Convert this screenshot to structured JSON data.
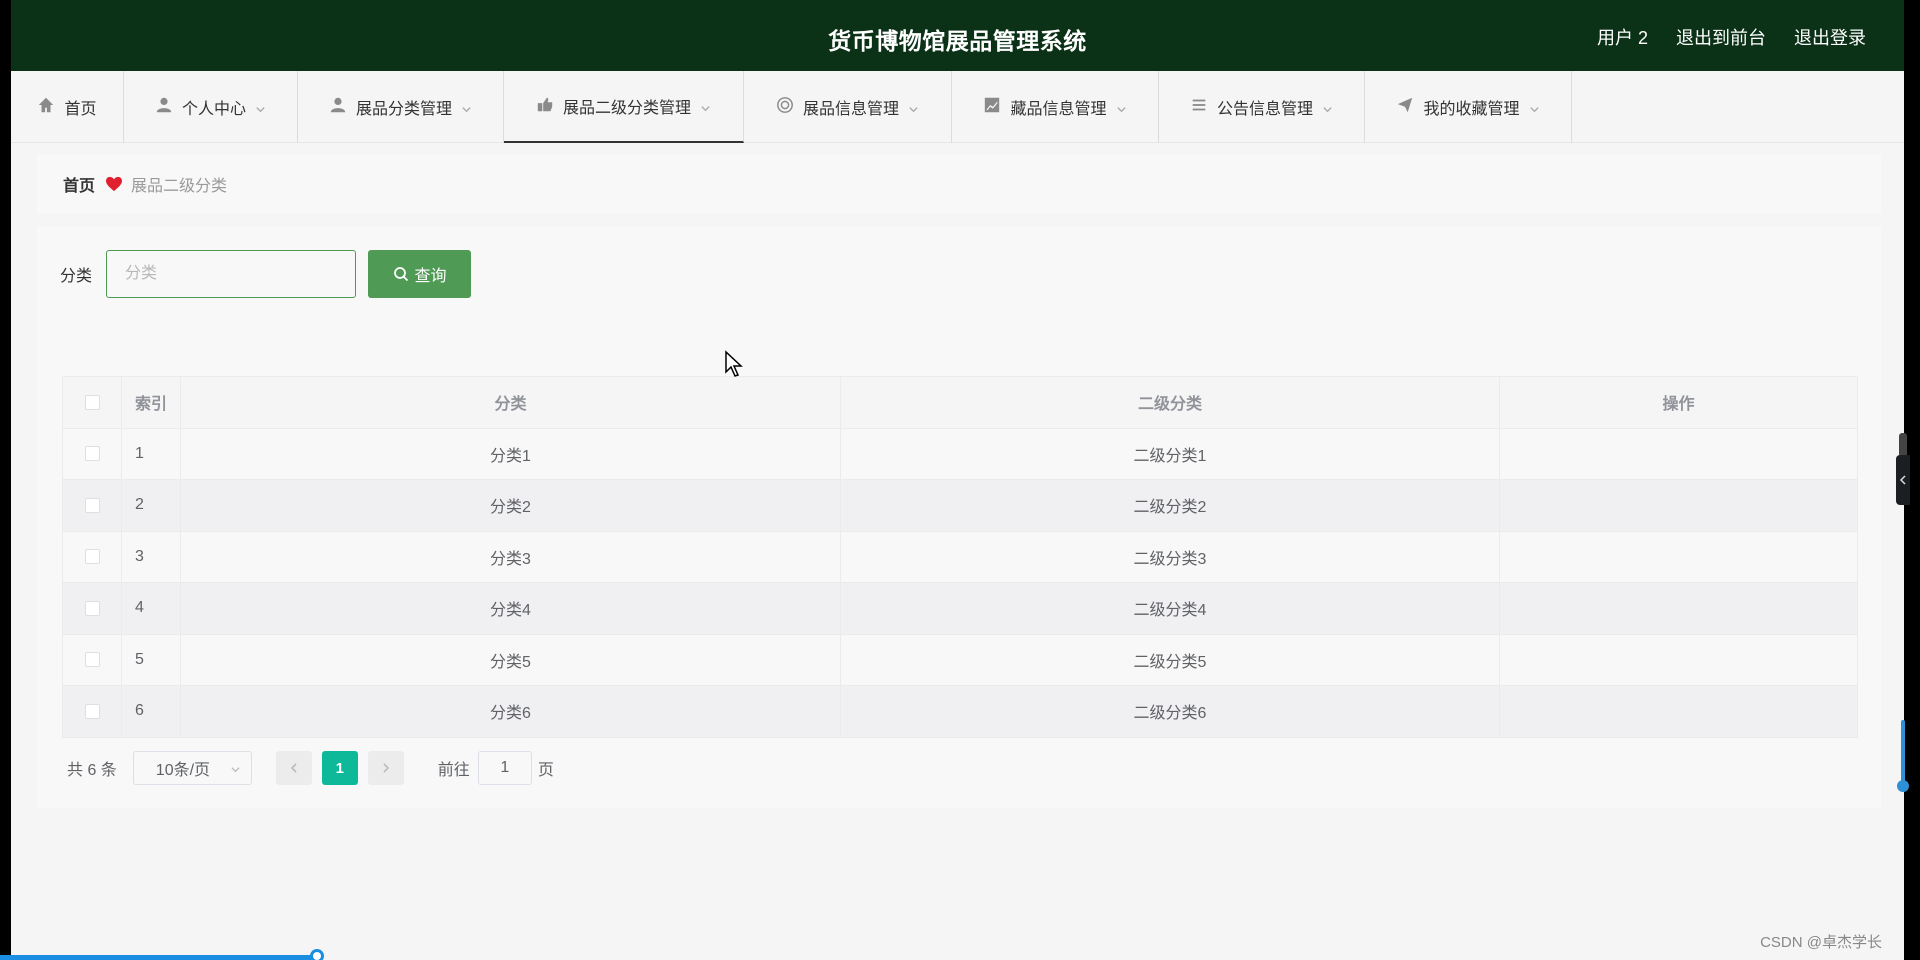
{
  "header": {
    "title": "货币博物馆展品管理系统",
    "user": "用户 2",
    "to_front": "退出到前台",
    "logout": "退出登录"
  },
  "nav": [
    {
      "label": "首页",
      "icon": "home-icon",
      "has_dropdown": false,
      "active": false
    },
    {
      "label": "个人中心",
      "icon": "user-icon",
      "has_dropdown": true,
      "active": false
    },
    {
      "label": "展品分类管理",
      "icon": "user-icon",
      "has_dropdown": true,
      "active": false
    },
    {
      "label": "展品二级分类管理",
      "icon": "tag-icon",
      "has_dropdown": true,
      "active": true
    },
    {
      "label": "展品信息管理",
      "icon": "lifebuoy-icon",
      "has_dropdown": true,
      "active": false
    },
    {
      "label": "藏品信息管理",
      "icon": "chart-icon",
      "has_dropdown": true,
      "active": false
    },
    {
      "label": "公告信息管理",
      "icon": "list-icon",
      "has_dropdown": true,
      "active": false
    },
    {
      "label": "我的收藏管理",
      "icon": "send-icon",
      "has_dropdown": true,
      "active": false
    }
  ],
  "breadcrumb": {
    "home": "首页",
    "current": "展品二级分类"
  },
  "search": {
    "label": "分类",
    "placeholder": "分类",
    "value": "",
    "button": "查询"
  },
  "table": {
    "headers": {
      "index": "索引",
      "category": "分类",
      "subcategory": "二级分类",
      "actions": "操作"
    },
    "rows": [
      {
        "index": "1",
        "category": "分类1",
        "subcategory": "二级分类1"
      },
      {
        "index": "2",
        "category": "分类2",
        "subcategory": "二级分类2"
      },
      {
        "index": "3",
        "category": "分类3",
        "subcategory": "二级分类3"
      },
      {
        "index": "4",
        "category": "分类4",
        "subcategory": "二级分类4"
      },
      {
        "index": "5",
        "category": "分类5",
        "subcategory": "二级分类5"
      },
      {
        "index": "6",
        "category": "分类6",
        "subcategory": "二级分类6"
      }
    ]
  },
  "pagination": {
    "total": "共 6 条",
    "page_size": "10条/页",
    "current_page": "1",
    "goto_prefix": "前往",
    "goto_value": "1",
    "goto_suffix": "页"
  },
  "watermark": "CSDN @卓杰学长",
  "colors": {
    "header_bg": "#0b3117",
    "accent": "#4f9a55",
    "page_active": "#0eb99a",
    "heart": "#e0202e"
  }
}
